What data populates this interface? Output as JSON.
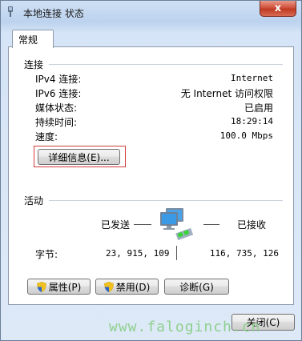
{
  "window": {
    "title": "本地连接 状态",
    "close_glyph": "x"
  },
  "tabs": [
    {
      "label": "常规"
    }
  ],
  "connection": {
    "heading": "连接",
    "rows": [
      {
        "label": "IPv4 连接:",
        "value": "Internet"
      },
      {
        "label": "IPv6 连接:",
        "value": "无 Internet 访问权限"
      },
      {
        "label": "媒体状态:",
        "value": "已启用"
      },
      {
        "label": "持续时间:",
        "value": "18:29:14"
      },
      {
        "label": "速度:",
        "value": "100.0 Mbps"
      }
    ],
    "details_button": "详细信息(E)..."
  },
  "activity": {
    "heading": "活动",
    "sent_label": "已发送",
    "received_label": "已接收",
    "bytes_label": "字节:",
    "bytes_sent": "23, 915, 109",
    "bytes_received": "116, 735, 126"
  },
  "buttons": {
    "properties": "属性(P)",
    "disable": "禁用(D)",
    "diagnose": "诊断(G)",
    "close": "关闭(C)"
  },
  "watermark": "www.faloginch.cn",
  "colors": {
    "highlight_frame": "#d23a3a",
    "close_button": "#c03a22",
    "watermark": "#8fd08f"
  }
}
